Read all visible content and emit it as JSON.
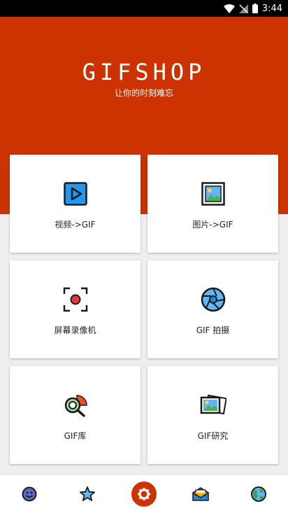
{
  "status_bar": {
    "time": "3:44"
  },
  "header": {
    "title": "GIFSHOP",
    "subtitle": "让你的时刻难忘",
    "bg_color": "#cc3300"
  },
  "tiles": [
    {
      "label": "视频->GIF",
      "icon": "video-play-icon"
    },
    {
      "label": "图片->GIF",
      "icon": "picture-icon"
    },
    {
      "label": "屏幕录像机",
      "icon": "screen-record-icon"
    },
    {
      "label": "GIF 拍摄",
      "icon": "camera-aperture-icon"
    },
    {
      "label": "GIF库",
      "icon": "gif-library-icon"
    },
    {
      "label": "GIF研究",
      "icon": "gif-research-icon"
    }
  ],
  "bottom_nav": {
    "items": [
      {
        "icon": "smiley-icon",
        "active": false
      },
      {
        "icon": "star-icon",
        "active": false
      },
      {
        "icon": "settings-gear-icon",
        "active": true
      },
      {
        "icon": "mail-icon",
        "active": false
      },
      {
        "icon": "globe-icon",
        "active": false
      }
    ]
  }
}
